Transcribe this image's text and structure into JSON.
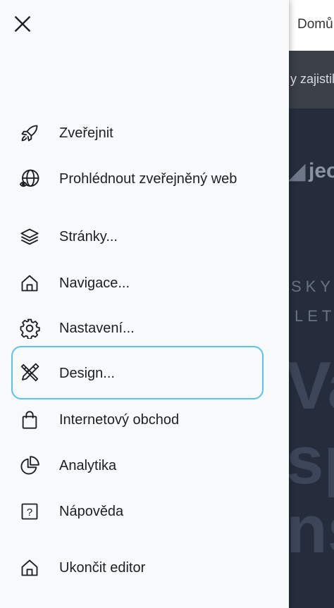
{
  "background": {
    "header_link": "Domů",
    "notice_text": "y zajistily",
    "logo_text": "jec",
    "subtitle_line1": "SKYT",
    "subtitle_line2": "LET",
    "hero_line1": "Va",
    "hero_line2": "sp",
    "hero_line3": "ns"
  },
  "drawer": {
    "close_icon": "close-icon",
    "items": [
      {
        "label": "Zveřejnit",
        "icon": "rocket-icon"
      },
      {
        "label": "Prohlédnout zveřejněný web",
        "icon": "globe-eye-icon"
      },
      {
        "label": "Stránky...",
        "icon": "layers-icon"
      },
      {
        "label": "Navigace...",
        "icon": "home-icon"
      },
      {
        "label": "Nastavení...",
        "icon": "gear-icon"
      },
      {
        "label": "Design...",
        "icon": "design-tools-icon",
        "active": true
      },
      {
        "label": "Internetový obchod",
        "icon": "shopping-bag-icon"
      },
      {
        "label": "Analytika",
        "icon": "pie-chart-icon"
      },
      {
        "label": "Nápověda",
        "icon": "help-icon"
      },
      {
        "label": "Ukončit editor",
        "icon": "exit-home-icon"
      }
    ]
  },
  "colors": {
    "drawer_bg": "#f8f9fa",
    "active_border": "#5cc2ec",
    "text": "#1d1f24",
    "backdrop": "#252d3c"
  }
}
